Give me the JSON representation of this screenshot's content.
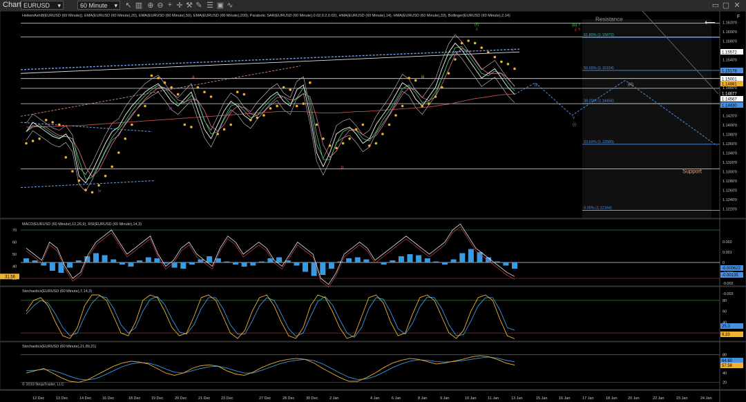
{
  "toolbar": {
    "title": "Chart",
    "instrument": "EURUSD",
    "interval": "60 Minute",
    "icons": [
      "plus-icon",
      "crosshair-icon",
      "zoom-in-icon",
      "zoom-out-icon",
      "bar-style-icon",
      "wrench-icon",
      "draw-icon",
      "properties-icon",
      "data-box-icon",
      "indicators-icon"
    ],
    "window_icons": [
      "minimize-icon",
      "maximize-icon",
      "close-icon"
    ]
  },
  "chart_data": [
    {
      "type": "line",
      "panel": "price",
      "title": "HeikenAshi8(EURUSD (60 Minute)), EMA(EURUSD (60 Minute),20), EMA(EURUSD (60 Minute),50), EMA(EURUSD (60 Minute),200), Parabolic SAR(EURUSD (60 Minute),0.02,0.2,0.02), HMA(EURUSD (60 Minute),14), HMA(EURUSD (60 Minute),33), Bollinger(EURUSD (60 Minute),2,14)",
      "ylim": [
        1.2208,
        1.1626
      ],
      "y_ticks": [
        "1.1620'0",
        "1.1600'0",
        "1.1580'0",
        "1.1560'0",
        "1.1540'0",
        "1.1520'0",
        "1.1500'0",
        "1.1480'0",
        "1.1460'0",
        "1.1440'0",
        "1.1420'0",
        "1.1400'0",
        "1.1380'0",
        "1.1360'0",
        "1.1340'0",
        "1.1320'0",
        "1.1300'0",
        "1.1280'0",
        "1.1260'0",
        "1.1240'0",
        "1.1220'0"
      ],
      "x_ticks": [
        "12 Dec",
        "13 Dec",
        "14 Dec",
        "16 Dec",
        "18 Dec",
        "19 Dec",
        "20 Dec",
        "21 Dec",
        "23 Dec",
        "27 Dec",
        "28 Dec",
        "30 Dec",
        "2 Jan",
        "4 Jan",
        "6 Jan",
        "8 Jan",
        "9 Jan",
        "10 Jan",
        "11 Jan",
        "13 Jan",
        "15 Jan",
        "16 Jan",
        "17 Jan",
        "18 Jan",
        "20 Jan",
        "22 Jan",
        "23 Jan",
        "24 Jan"
      ],
      "price_series": [
        1.1385,
        1.1405,
        1.1395,
        1.1385,
        1.1375,
        1.137,
        1.138,
        1.136,
        1.129,
        1.1275,
        1.13,
        1.133,
        1.136,
        1.1385,
        1.1395,
        1.142,
        1.144,
        1.1455,
        1.147,
        1.148,
        1.1488,
        1.147,
        1.145,
        1.144,
        1.1455,
        1.147,
        1.143,
        1.139,
        1.137,
        1.14,
        1.143,
        1.145,
        1.144,
        1.142,
        1.141,
        1.143,
        1.1445,
        1.146,
        1.147,
        1.145,
        1.144,
        1.1475,
        1.1485,
        1.142,
        1.134,
        1.131,
        1.134,
        1.138,
        1.139,
        1.1395,
        1.138,
        1.136,
        1.137,
        1.14,
        1.142,
        1.144,
        1.1465,
        1.149,
        1.148,
        1.1455,
        1.144,
        1.146,
        1.148,
        1.152,
        1.1555,
        1.1575,
        1.156,
        1.154,
        1.152,
        1.15,
        1.151,
        1.152,
        1.15,
        1.148,
        1.1465
      ],
      "sar_series": [
        1.136,
        1.1365,
        1.137,
        1.141,
        1.1405,
        1.14,
        1.133,
        1.13,
        1.128,
        1.126,
        1.1255,
        1.127,
        1.129,
        1.131,
        1.134,
        1.137,
        1.14,
        1.142,
        1.144,
        1.1505,
        1.15,
        1.149,
        1.148,
        1.1465,
        1.14,
        1.1395,
        1.148,
        1.147,
        1.146,
        1.138,
        1.139,
        1.14,
        1.147,
        1.1465,
        1.141,
        1.1415,
        1.142,
        1.1435,
        1.144,
        1.148,
        1.1475,
        1.144,
        1.1445,
        1.149,
        1.14,
        1.137,
        1.1355,
        1.135,
        1.136,
        1.137,
        1.139,
        1.14,
        1.1355,
        1.136,
        1.138,
        1.14,
        1.142,
        1.144,
        1.15,
        1.1495,
        1.144,
        1.1445,
        1.146,
        1.148,
        1.151,
        1.154,
        1.1575,
        1.158,
        1.1575,
        1.1565,
        1.1555,
        1.1545,
        1.1535,
        1.153,
        1.152
      ],
      "ema200_series": [
        1.1395,
        1.1395,
        1.1396,
        1.1396,
        1.1396,
        1.1397,
        1.1397,
        1.1398,
        1.1398,
        1.1399,
        1.14,
        1.1401,
        1.1402,
        1.1403,
        1.1404,
        1.1405,
        1.1406,
        1.1407,
        1.1408,
        1.1409,
        1.141,
        1.1411,
        1.1412,
        1.1413,
        1.1414,
        1.1415,
        1.1416,
        1.1417,
        1.1418,
        1.1419,
        1.142,
        1.1421,
        1.1422,
        1.1423,
        1.1424,
        1.1425,
        1.1426,
        1.1427,
        1.1428,
        1.1428,
        1.1428,
        1.1428,
        1.1428,
        1.1427,
        1.1426,
        1.1425,
        1.1425,
        1.1425,
        1.1426,
        1.1427,
        1.1428,
        1.1428,
        1.1429,
        1.143,
        1.1431,
        1.1432,
        1.1433,
        1.1434,
        1.1435,
        1.1436,
        1.1437,
        1.1438,
        1.144,
        1.1442,
        1.1444,
        1.1447,
        1.145,
        1.1453,
        1.1456,
        1.1458,
        1.146,
        1.1462,
        1.1464,
        1.1465,
        1.1466
      ],
      "fib_levels": [
        {
          "label": "61.80% (1.15872)",
          "value": 1.15872
        },
        {
          "label": "50.00% (1.15164)",
          "value": 1.15164
        },
        {
          "label": "38.20% (1.14456)",
          "value": 1.14456
        },
        {
          "label": "23.60% (1.13580)",
          "value": 1.1358
        },
        {
          "label": "0.00% (1.12164)",
          "value": 1.12164
        }
      ],
      "horizontal_lines": [
        1.1618,
        1.1588,
        1.1499,
        1.1478,
        1.1445,
        1.1305
      ],
      "text_labels": [
        "Resistance",
        "Support"
      ],
      "price_tags": [
        {
          "text": "1.15572",
          "value": 1.15572,
          "bg": "#ffffff",
          "fg": "#000000"
        },
        {
          "text": "1.15178",
          "value": 1.15178,
          "bg": "#4a90e2",
          "fg": "#000000"
        },
        {
          "text": "1.15001",
          "value": 1.15001,
          "bg": "#ffffff",
          "fg": "#000000"
        },
        {
          "text": "1.14881",
          "value": 1.14881,
          "bg": "#f0b030",
          "fg": "#000000"
        },
        {
          "text": "1.14677",
          "value": 1.14677,
          "bg": "#000000",
          "fg": "#ffffff"
        },
        {
          "text": "1.14567",
          "value": 1.14567,
          "bg": "#ffffff",
          "fg": "#000000"
        },
        {
          "text": "1.14430",
          "value": 1.1443,
          "bg": "#4a90e2",
          "fg": "#000000"
        }
      ],
      "wave_labels": [
        {
          "text": "a",
          "color": "#e05050"
        },
        {
          "text": "b",
          "color": "#e05050"
        },
        {
          "text": "c",
          "color": "#e05050"
        },
        {
          "text": "ii",
          "color": "#e05050"
        },
        {
          "text": "iii",
          "color": "#c050c0"
        },
        {
          "text": "iii",
          "color": "#c0c040"
        },
        {
          "text": "iv",
          "color": "#c050c0"
        },
        {
          "text": "iv",
          "color": "#4a90e2"
        },
        {
          "text": "v",
          "color": "#4a90e2"
        },
        {
          "text": "(i)",
          "color": "#e05050"
        },
        {
          "text": "(iii)",
          "color": "#e0a050"
        },
        {
          "text": "(ii)",
          "color": "#40c040"
        },
        {
          "text": "c ?",
          "color": "#e05050"
        },
        {
          "text": "(b) ?",
          "color": "#40c040"
        }
      ],
      "copyright": "© 2019 NinjaTrader, LLC"
    },
    {
      "type": "line",
      "panel": "macd-rsi",
      "title": "MACD(EURUSD (60 Minute),12,26,9), RSI(EURUSD (60 Minute),14,3)",
      "left_ticks": [
        "70",
        "60",
        "50",
        "40",
        "30"
      ],
      "right_ticks": [
        "0.002",
        "0.001",
        "0",
        "-0.001",
        "-0.002",
        "-0.003"
      ],
      "left_tag": {
        "text": "31.56",
        "bg": "#f0b030"
      },
      "right_tags": [
        {
          "text": "-0.000622",
          "bg": "#4a90e2"
        },
        {
          "text": "-0.00135",
          "bg": "#4a90e2"
        }
      ],
      "rsi_series": [
        55,
        50,
        45,
        60,
        55,
        40,
        30,
        35,
        50,
        60,
        65,
        70,
        60,
        50,
        55,
        60,
        65,
        50,
        40,
        45,
        55,
        60,
        50,
        45,
        40,
        55,
        65,
        60,
        50,
        55,
        60,
        55,
        45,
        40,
        50,
        60,
        55,
        50,
        30,
        25,
        35,
        50,
        55,
        60,
        55,
        45,
        50,
        55,
        60,
        65,
        60,
        55,
        50,
        55,
        60,
        70,
        75,
        65,
        55,
        50,
        45,
        40,
        35,
        31.56
      ],
      "macd_hist": [
        0.0004,
        0.0002,
        -0.0003,
        -0.0008,
        -0.001,
        -0.0005,
        0.0002,
        0.0006,
        0.0009,
        0.0007,
        0.0003,
        -0.0002,
        -0.0004,
        0.0002,
        0.0005,
        0.0004,
        -0.0001,
        -0.0005,
        -0.0006,
        -0.0002,
        0.0003,
        0.0006,
        0.0004,
        0.0001,
        -0.0002,
        -0.0004,
        -0.0003,
        0.0001,
        0.0004,
        0.0005,
        0.0002,
        -0.0003,
        -0.0009,
        -0.0013,
        -0.0012,
        -0.0006,
        0.0001,
        0.0004,
        0.0005,
        0.0003,
        0.0,
        -0.0002,
        0.0002,
        0.0006,
        0.0008,
        0.0007,
        0.0004,
        0.0001,
        -0.0002,
        0.0003,
        0.0009,
        0.0013,
        0.001,
        0.0005,
        0.0001,
        -0.0003,
        -0.0006
      ]
    },
    {
      "type": "line",
      "panel": "stochastics-fast",
      "title": "Stochastics(EURUSD (60 Minute),7,14,3)",
      "right_ticks": [
        "80",
        "60",
        "40",
        "20"
      ],
      "right_tags": [
        {
          "text": "25.3",
          "bg": "#4a90e2"
        },
        {
          "text": "9.33",
          "bg": "#f0b030"
        }
      ],
      "k_series": [
        60,
        80,
        85,
        70,
        40,
        15,
        10,
        30,
        70,
        90,
        90,
        80,
        50,
        20,
        15,
        40,
        80,
        90,
        85,
        60,
        30,
        15,
        20,
        50,
        85,
        90,
        80,
        50,
        20,
        10,
        25,
        60,
        85,
        90,
        70,
        40,
        15,
        10,
        30,
        70,
        90,
        85,
        60,
        30,
        10,
        15,
        50,
        85,
        90,
        75,
        40,
        15,
        20,
        55,
        85,
        90,
        80,
        50,
        20,
        10,
        25,
        60,
        85,
        90,
        80,
        45,
        15,
        9.33
      ],
      "d_series": [
        55,
        70,
        80,
        75,
        55,
        30,
        15,
        20,
        50,
        75,
        88,
        85,
        65,
        35,
        20,
        30,
        60,
        82,
        87,
        72,
        45,
        22,
        18,
        35,
        65,
        85,
        85,
        65,
        35,
        18,
        18,
        42,
        70,
        85,
        80,
        55,
        28,
        14,
        20,
        50,
        78,
        87,
        72,
        45,
        20,
        12,
        30,
        65,
        85,
        82,
        58,
        28,
        18,
        38,
        68,
        86,
        85,
        65,
        35,
        15,
        17,
        42,
        70,
        85,
        85,
        62,
        30,
        25.3
      ]
    },
    {
      "type": "line",
      "panel": "stochastics-slow",
      "title": "Stochastics(EURUSD (60 Minute),21,89,21)",
      "right_ticks": [
        "80",
        "60",
        "40",
        "20"
      ],
      "right_tags": [
        {
          "text": "64.60",
          "bg": "#4a90e2"
        },
        {
          "text": "57.58",
          "bg": "#f0b030"
        }
      ],
      "k_series": [
        40,
        45,
        50,
        40,
        30,
        22,
        20,
        25,
        35,
        45,
        55,
        62,
        66,
        64,
        60,
        50,
        40,
        35,
        40,
        50,
        56,
        58,
        55,
        45,
        38,
        35,
        42,
        52,
        60,
        66,
        70,
        72,
        70,
        62,
        50,
        40,
        30,
        22,
        22,
        30,
        40,
        52,
        62,
        68,
        72,
        70,
        65,
        60,
        62,
        66,
        70,
        75,
        78,
        76,
        70,
        62,
        57.58
      ],
      "d_series": [
        45,
        46,
        48,
        46,
        40,
        33,
        27,
        25,
        28,
        36,
        45,
        54,
        60,
        63,
        62,
        57,
        49,
        42,
        40,
        45,
        50,
        54,
        55,
        51,
        45,
        40,
        40,
        46,
        53,
        60,
        65,
        68,
        70,
        67,
        60,
        50,
        40,
        31,
        26,
        27,
        33,
        42,
        52,
        60,
        66,
        69,
        68,
        65,
        64,
        65,
        67,
        70,
        73,
        75,
        73,
        68,
        64.6
      ]
    }
  ]
}
